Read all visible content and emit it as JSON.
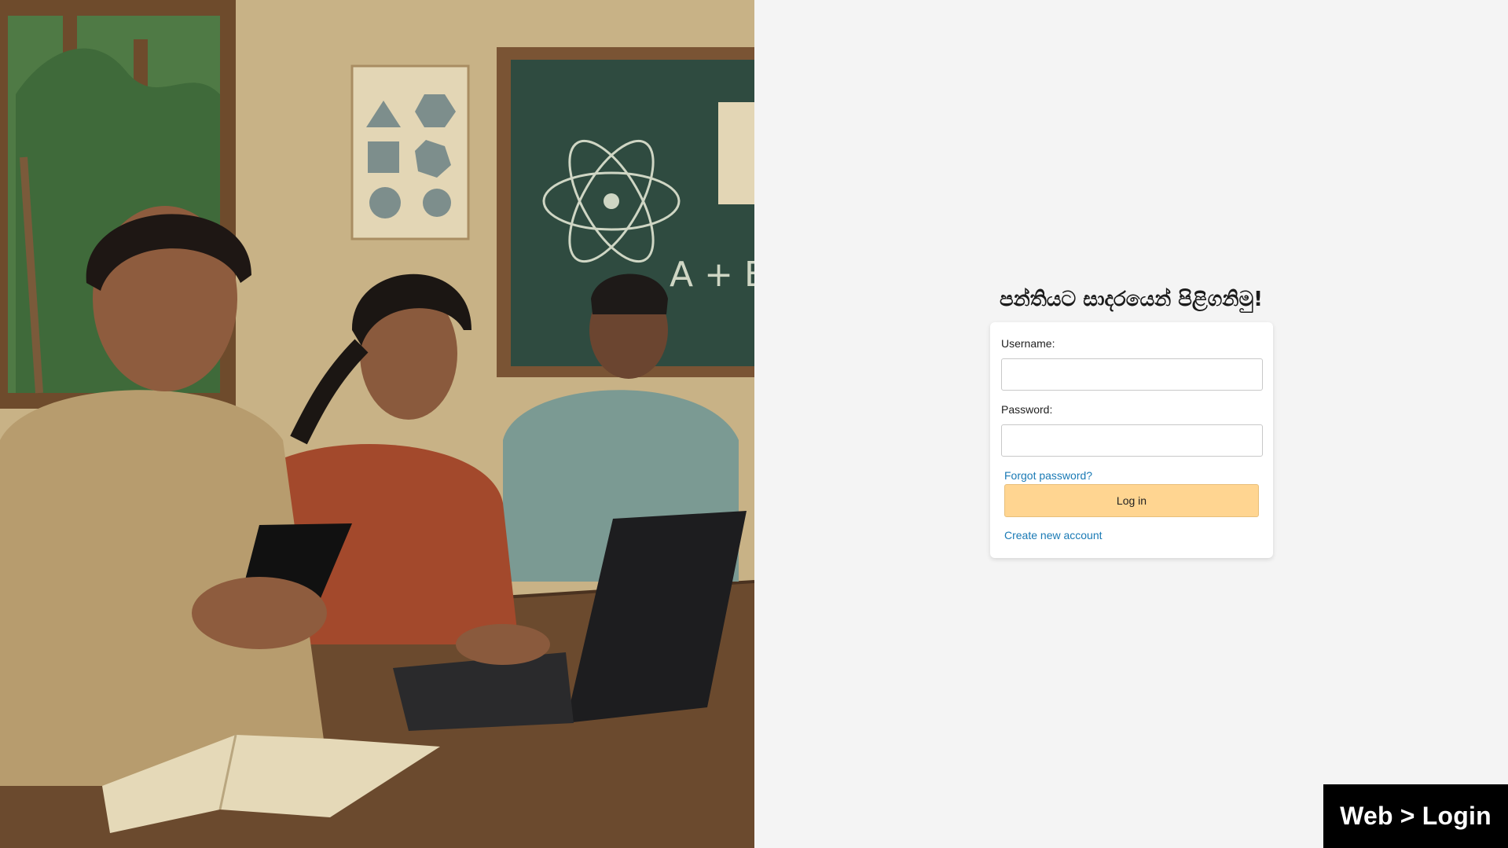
{
  "welcome": {
    "title": "පන්තියට සාදරයෙන් පිළිගනිමු!"
  },
  "login_form": {
    "username_label": "Username:",
    "username_value": "",
    "password_label": "Password:",
    "password_value": "",
    "forgot_password": "Forgot password?",
    "login_button": "Log in",
    "create_account": "Create new account"
  },
  "hero": {
    "description_icon": "classroom-illustration",
    "blackboard_text": "A + B ="
  },
  "badge": {
    "label": "Web > Login"
  },
  "colors": {
    "background": "#f4f4f4",
    "card": "#ffffff",
    "button": "#ffd591",
    "link": "#1a7ab5",
    "badge": "#000000"
  }
}
